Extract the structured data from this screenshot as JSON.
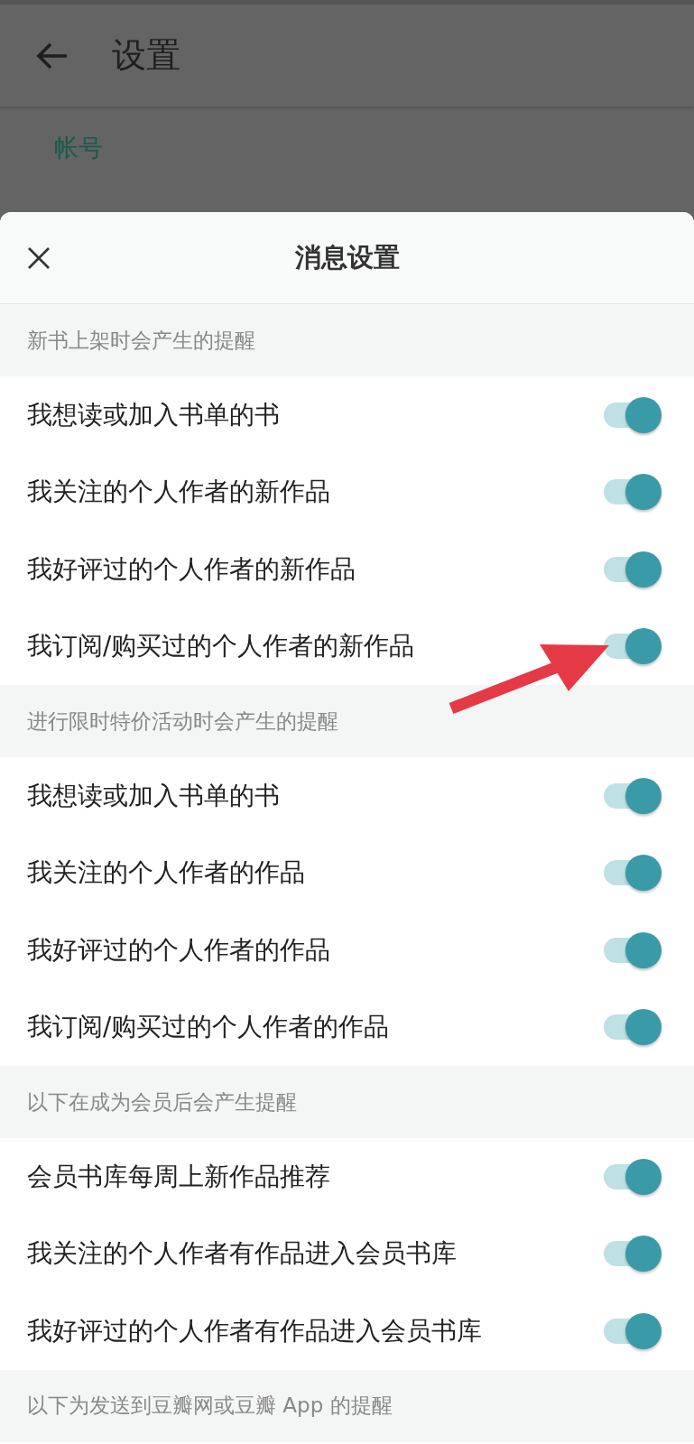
{
  "background": {
    "title": "设置",
    "section_label": "帐号"
  },
  "sheet": {
    "title": "消息设置",
    "sections": [
      {
        "header": "新书上架时会产生的提醒",
        "items": [
          {
            "label": "我想读或加入书单的书",
            "on": true
          },
          {
            "label": "我关注的个人作者的新作品",
            "on": true
          },
          {
            "label": "我好评过的个人作者的新作品",
            "on": true
          },
          {
            "label": "我订阅/购买过的个人作者的新作品",
            "on": true
          }
        ]
      },
      {
        "header": "进行限时特价活动时会产生的提醒",
        "items": [
          {
            "label": "我想读或加入书单的书",
            "on": true
          },
          {
            "label": "我关注的个人作者的作品",
            "on": true
          },
          {
            "label": "我好评过的个人作者的作品",
            "on": true
          },
          {
            "label": "我订阅/购买过的个人作者的作品",
            "on": true
          }
        ]
      },
      {
        "header": "以下在成为会员后会产生提醒",
        "items": [
          {
            "label": "会员书库每周上新作品推荐",
            "on": true
          },
          {
            "label": "我关注的个人作者有作品进入会员书库",
            "on": true
          },
          {
            "label": "我好评过的个人作者有作品进入会员书库",
            "on": true
          }
        ]
      },
      {
        "header": "以下为发送到豆瓣网或豆瓣 App 的提醒"
      }
    ]
  }
}
